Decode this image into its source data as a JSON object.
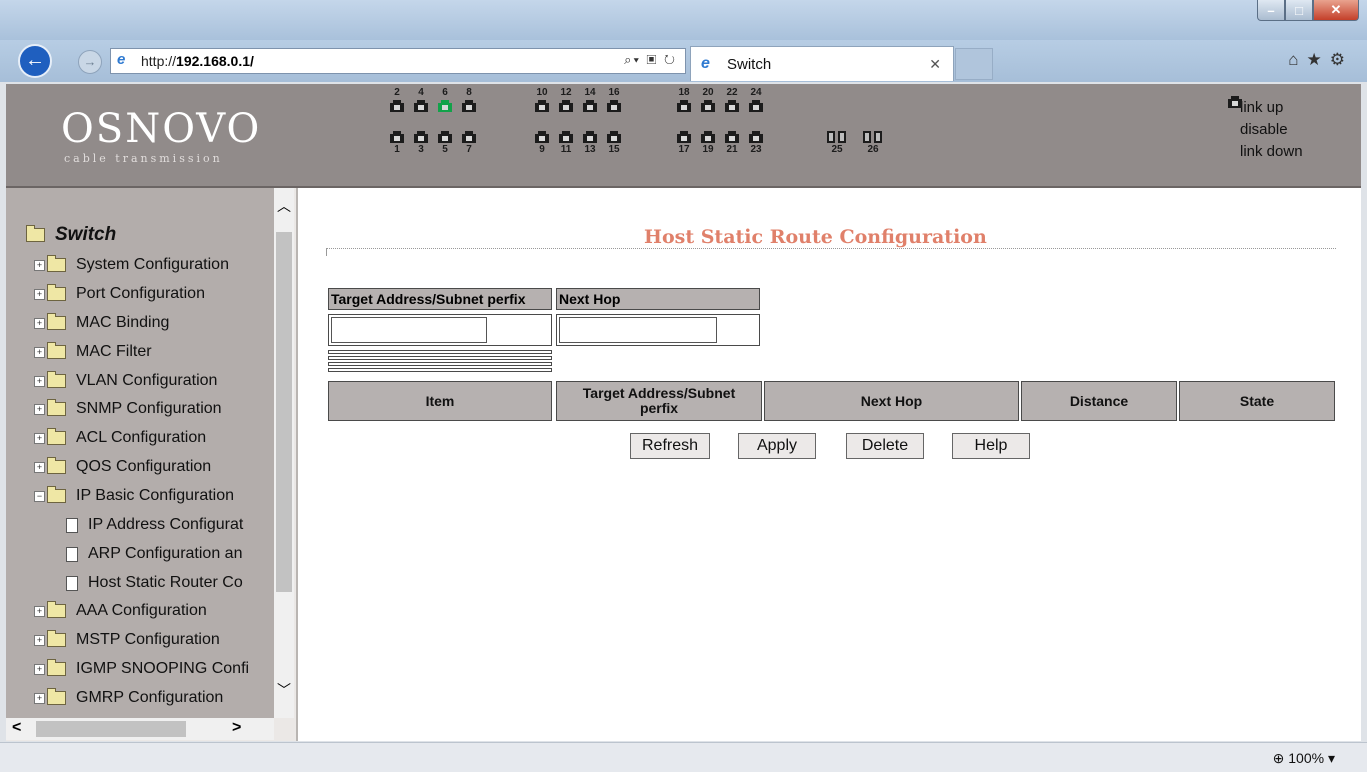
{
  "browser": {
    "address_url_prefix": "http://",
    "address_url_host": "192.168.0.1/",
    "tab_title": "Switch",
    "zoom": "100%"
  },
  "header": {
    "logo": "OSNOVO",
    "logo_sub": "cable transmission",
    "ports_top": [
      "2",
      "4",
      "6",
      "8",
      "10",
      "12",
      "14",
      "16",
      "18",
      "20",
      "22",
      "24"
    ],
    "ports_bottom": [
      "1",
      "3",
      "5",
      "7",
      "9",
      "11",
      "13",
      "15",
      "17",
      "19",
      "21",
      "23"
    ],
    "fiber_ports": [
      "25",
      "26"
    ],
    "link_up_port": "6",
    "legend": [
      {
        "label": "link up",
        "color": "#12a24a"
      },
      {
        "label": "disable",
        "color": "#d9261c"
      },
      {
        "label": "link down",
        "color": "#1c1c1c"
      }
    ]
  },
  "sidebar": {
    "root": "Switch",
    "items": [
      {
        "label": "System Configuration"
      },
      {
        "label": "Port Configuration"
      },
      {
        "label": "MAC Binding"
      },
      {
        "label": "MAC Filter"
      },
      {
        "label": "VLAN Configuration"
      },
      {
        "label": "SNMP Configuration"
      },
      {
        "label": "ACL Configuration"
      },
      {
        "label": "QOS Configuration"
      },
      {
        "label": "IP Basic Configuration"
      },
      {
        "label": "IP Address Configurat"
      },
      {
        "label": "ARP Configuration an"
      },
      {
        "label": "Host Static Router Co"
      },
      {
        "label": "AAA Configuration"
      },
      {
        "label": "MSTP Configuration"
      },
      {
        "label": "IGMP SNOOPING Confi"
      },
      {
        "label": "GMRP Configuration"
      }
    ]
  },
  "main": {
    "title": "Host Static Route Configuration",
    "input_headers": [
      "Target Address/Subnet perfix",
      "Next Hop"
    ],
    "list_headers": [
      "Item",
      "Target Address/Subnet perfix",
      "Next Hop",
      "Distance",
      "State"
    ],
    "buttons": [
      "Refresh",
      "Apply",
      "Delete",
      "Help"
    ]
  }
}
